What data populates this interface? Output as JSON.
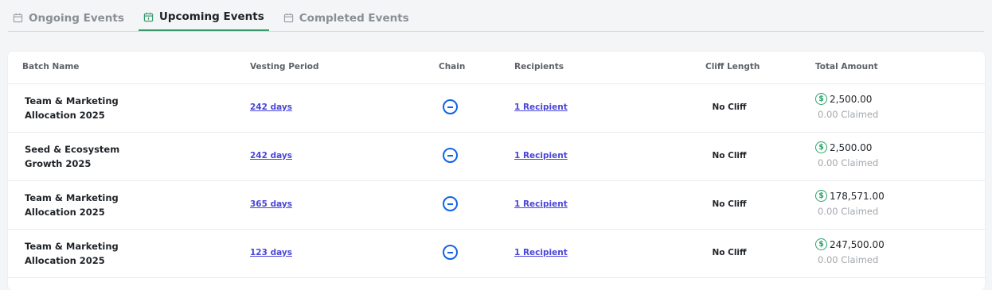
{
  "tabs": [
    {
      "label": "Ongoing Events",
      "icon": "calendar-icon",
      "active": false
    },
    {
      "label": "Upcoming Events",
      "icon": "calendar-icon",
      "active": true
    },
    {
      "label": "Completed Events",
      "icon": "calendar-icon",
      "active": false
    }
  ],
  "table": {
    "headers": {
      "batch_name": "Batch Name",
      "vesting_period": "Vesting Period",
      "chain": "Chain",
      "recipients": "Recipients",
      "cliff_length": "Cliff Length",
      "total_amount": "Total Amount"
    },
    "rows": [
      {
        "name_line1": "Team & Marketing",
        "name_line2": "Allocation 2025",
        "vesting": "242 days",
        "chain_icon": "chain-icon",
        "recipients": "1 Recipient",
        "cliff": "No Cliff",
        "amount": "2,500.00",
        "claimed": "0.00 Claimed"
      },
      {
        "name_line1": "Seed & Ecosystem",
        "name_line2": "Growth 2025",
        "vesting": "242 days",
        "chain_icon": "chain-icon",
        "recipients": "1 Recipient",
        "cliff": "No Cliff",
        "amount": "2,500.00",
        "claimed": "0.00 Claimed"
      },
      {
        "name_line1": "Team & Marketing",
        "name_line2": "Allocation 2025",
        "vesting": "365 days",
        "chain_icon": "chain-icon",
        "recipients": "1 Recipient",
        "cliff": "No Cliff",
        "amount": "178,571.00",
        "claimed": "0.00 Claimed"
      },
      {
        "name_line1": "Team & Marketing",
        "name_line2": "Allocation 2025",
        "vesting": "123 days",
        "chain_icon": "chain-icon",
        "recipients": "1 Recipient",
        "cliff": "No Cliff",
        "amount": "247,500.00",
        "claimed": "0.00 Claimed"
      }
    ]
  },
  "colors": {
    "accent": "#3a9a6e",
    "link": "#4a46d8",
    "chain": "#1163e8",
    "currency": "#2aa46a"
  }
}
